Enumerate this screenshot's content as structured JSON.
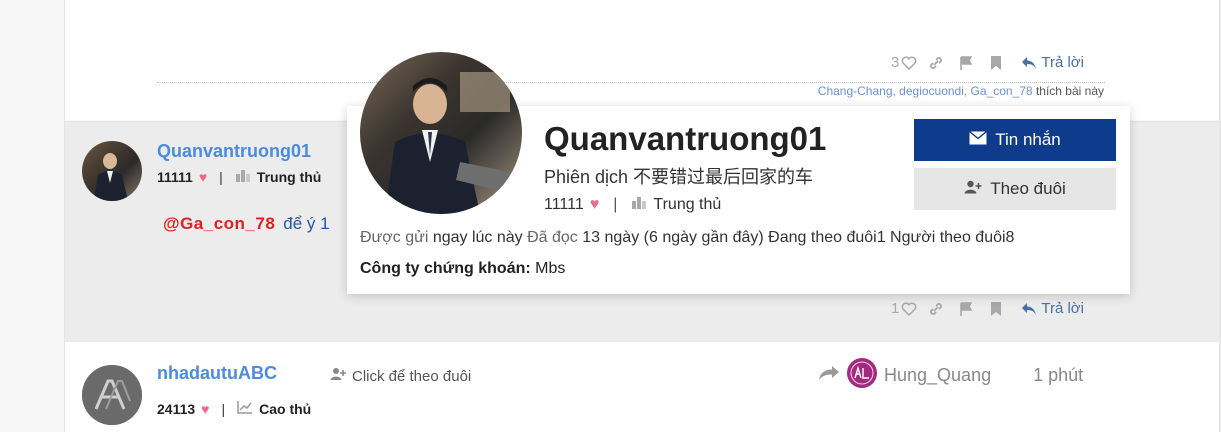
{
  "post1": {
    "like_count": "3",
    "reply_label": "Trả lời",
    "likers_names": "Chang-Chang, degiocuondi, Ga_con_78",
    "likers_suffix": " thích bài này"
  },
  "post2": {
    "username": "Quanvantruong01",
    "points": "11111",
    "rank": "Trung thủ",
    "mention": "@Ga_con_78",
    "text": "để ý 1",
    "like_count": "1",
    "reply_label": "Trả lời"
  },
  "post3": {
    "username": "nhadautuABC",
    "follow_label": "Click để theo đuôi",
    "points": "24113",
    "rank": "Cao thủ",
    "shared_by": "Hung_Quang",
    "time": "1 phút"
  },
  "popup": {
    "name": "Quanvantruong01",
    "title": "Phiên dịch 不要错过最后回家的车",
    "points": "11111",
    "rank": "Trung thủ",
    "sent_label": "Được gửi",
    "sent_value": " ngay lúc này ",
    "read_label": "Đã đọc",
    "read_value": " 13 ngày (6 ngày gần đây) ",
    "following_label": "Đang theo đuôi",
    "following_value": "1 ",
    "followers_label": "Người theo đuôi",
    "followers_value": "8",
    "company_label": "Công ty chứng khoán:",
    "company_value": " Mbs",
    "message_button": "Tin nhắn",
    "follow_button": "Theo đuôi"
  },
  "colors": {
    "username": "#4a8be0",
    "mention": "#e02020",
    "message_button_bg": "#0f3b8c",
    "heart": "#f06a86",
    "reply": "#4a6fa5"
  }
}
